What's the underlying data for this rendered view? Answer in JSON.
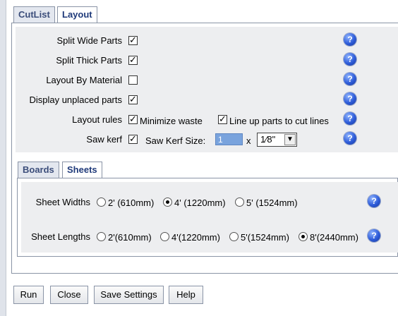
{
  "tabs": [
    {
      "label": "CutList",
      "active": false
    },
    {
      "label": "Layout",
      "active": true
    }
  ],
  "layout": {
    "split_wide": {
      "label": "Split Wide Parts",
      "checked": true
    },
    "split_thick": {
      "label": "Split Thick Parts",
      "checked": true
    },
    "by_material": {
      "label": "Layout By Material",
      "checked": false
    },
    "display_unplaced": {
      "label": "Display unplaced parts",
      "checked": true
    },
    "layout_rules": {
      "label": "Layout rules",
      "minimize_waste": {
        "label": "Minimize waste",
        "checked": true
      },
      "line_up": {
        "label": "Line up parts to cut lines",
        "checked": true
      }
    },
    "saw_kerf": {
      "label": "Saw kerf",
      "checked": true,
      "size_label": "Saw Kerf Size:",
      "size_value": "1",
      "times": "x",
      "fraction": "1⁄8\""
    }
  },
  "subtabs": [
    {
      "label": "Boards",
      "active": false
    },
    {
      "label": "Sheets",
      "active": true
    }
  ],
  "sheets": {
    "widths": {
      "label": "Sheet Widths",
      "options": [
        {
          "label": "2' (610mm)",
          "selected": false
        },
        {
          "label": "4' (1220mm)",
          "selected": true
        },
        {
          "label": "5' (1524mm)",
          "selected": false
        }
      ]
    },
    "lengths": {
      "label": "Sheet Lengths",
      "options": [
        {
          "label": "2'(610mm)",
          "selected": false
        },
        {
          "label": "4'(1220mm)",
          "selected": false
        },
        {
          "label": "5'(1524mm)",
          "selected": false
        },
        {
          "label": "8'(2440mm)",
          "selected": true
        }
      ]
    }
  },
  "help_glyph": "?",
  "buttons": {
    "run": "Run",
    "close": "Close",
    "save_settings": "Save Settings",
    "help": "Help"
  },
  "colors": {
    "tab_text": "#3b4d7a",
    "panel_bg": "#edeef0",
    "help_icon": "#2d5bd8",
    "kerf_input_bg": "#79a3dd"
  }
}
